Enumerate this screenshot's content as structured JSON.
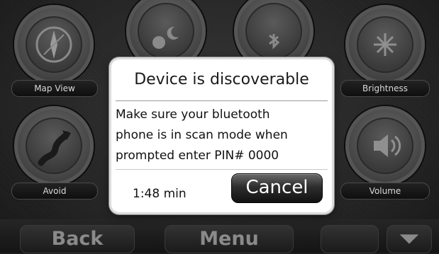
{
  "tiles": [
    {
      "label": "Map View",
      "icon": "compass-icon"
    },
    {
      "label": "",
      "icon": "day-night-icon"
    },
    {
      "label": "",
      "icon": "bluetooth-icon"
    },
    {
      "label": "Brightness",
      "icon": "brightness-icon"
    },
    {
      "label": "Avoid",
      "icon": "avoid-route-icon"
    },
    {
      "label": "Volume",
      "icon": "volume-icon"
    }
  ],
  "bottom_bar": {
    "back_label": "Back",
    "menu_label": "Menu",
    "more_icon": "triangle-down-icon"
  },
  "dialog": {
    "title": "Device is discoverable",
    "message_lines": [
      "Make sure your bluetooth",
      "phone is in scan mode when",
      "prompted enter PIN# 0000"
    ],
    "timer": "1:48 min",
    "cancel_label": "Cancel"
  },
  "colors": {
    "dialog_bg": "#ffffff",
    "screen_bg": "#1d1d1d",
    "cancel_button": "#2e2e2e"
  }
}
